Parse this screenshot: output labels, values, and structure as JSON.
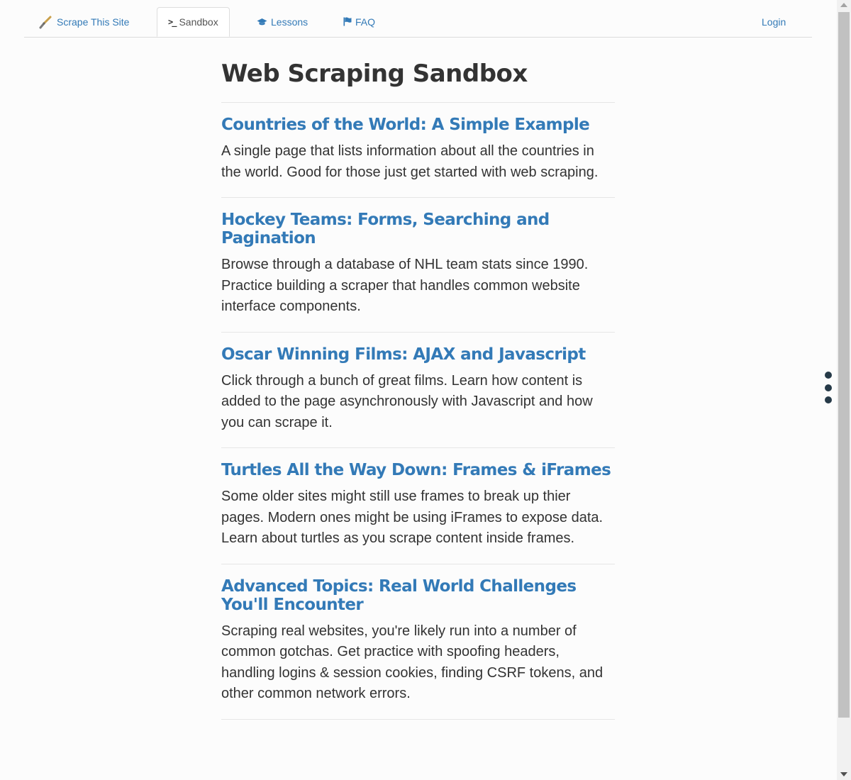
{
  "nav": {
    "home_label": "Scrape This Site",
    "sandbox_label": "Sandbox",
    "sandbox_icon_text": ">_",
    "lessons_label": "Lessons",
    "faq_label": "FAQ",
    "login_label": "Login"
  },
  "page": {
    "title": "Web Scraping Sandbox"
  },
  "items": [
    {
      "title": "Countries of the World: A Simple Example",
      "description": "A single page that lists information about all the countries in the world. Good for those just get started with web scraping."
    },
    {
      "title": "Hockey Teams: Forms, Searching and Pagination",
      "description": "Browse through a database of NHL team stats since 1990. Practice building a scraper that handles common website interface components."
    },
    {
      "title": "Oscar Winning Films: AJAX and Javascript",
      "description": "Click through a bunch of great films. Learn how content is added to the page asynchronously with Javascript and how you can scrape it."
    },
    {
      "title": "Turtles All the Way Down: Frames & iFrames",
      "description": "Some older sites might still use frames to break up thier pages. Modern ones might be using iFrames to expose data. Learn about turtles as you scrape content inside frames."
    },
    {
      "title": "Advanced Topics: Real World Challenges You'll Encounter",
      "description": "Scraping real websites, you're likely run into a number of common gotchas. Get practice with spoofing headers, handling logins & session cookies, finding CSRF tokens, and other common network errors."
    }
  ],
  "icons": {
    "home": "spatula-icon",
    "sandbox": "terminal-icon",
    "lessons": "graduation-cap-icon",
    "faq": "flag-icon",
    "more": "vertical-dots-icon"
  },
  "colors": {
    "link": "#337ab7",
    "text": "#333333",
    "background": "#fcfcfc",
    "dots": "#263a48"
  }
}
